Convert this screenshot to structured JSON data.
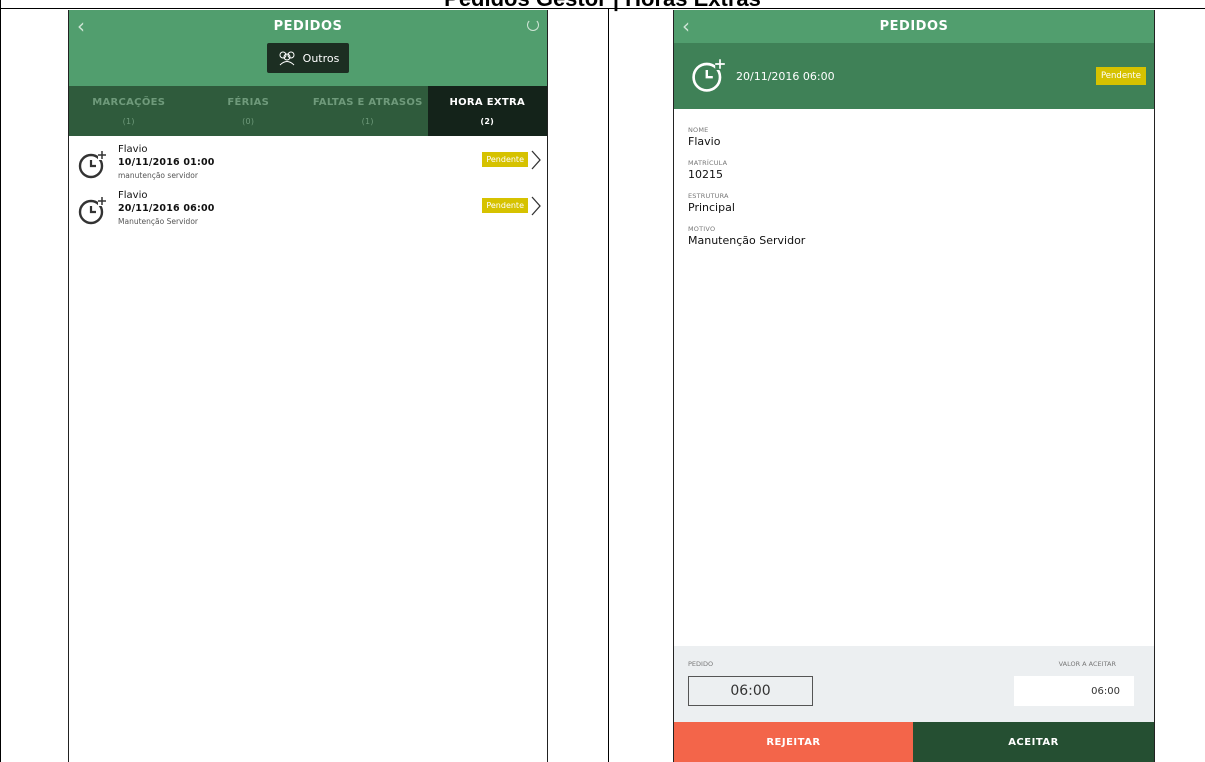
{
  "document": {
    "title": "Pedidos Gestor | Horas Extras"
  },
  "left": {
    "header": {
      "back_icon": "chevron-left-icon",
      "title": "PEDIDOS",
      "refresh_icon": "refresh-icon"
    },
    "filter": {
      "label": "Outros",
      "icon": "people-icon"
    },
    "tabs": [
      {
        "label": "MARCAÇÕES",
        "count": "(1)"
      },
      {
        "label": "FÉRIAS",
        "count": "(0)"
      },
      {
        "label": "FALTAS E ATRASOS",
        "count": "(1)"
      },
      {
        "label": "HORA EXTRA",
        "count": "(2)"
      }
    ],
    "active_tab": "HORA EXTRA",
    "items": [
      {
        "name": "Flavio",
        "datetime": "10/11/2016 01:00",
        "reason": "manutenção servidor",
        "status": "Pendente"
      },
      {
        "name": "Flavio",
        "datetime": "20/11/2016 06:00",
        "reason": "Manutenção Servidor",
        "status": "Pendente"
      }
    ]
  },
  "right": {
    "header": {
      "back_icon": "chevron-left-icon",
      "title": "PEDIDOS"
    },
    "summary": {
      "icon": "clock-plus-icon",
      "datetime": "20/11/2016 06:00",
      "status": "Pendente"
    },
    "fields": [
      {
        "label": "NOME",
        "value": "Flavio"
      },
      {
        "label": "MATRÍCULA",
        "value": "10215"
      },
      {
        "label": "ESTRUTURA",
        "value": "Principal"
      },
      {
        "label": "MOTIVO",
        "value": "Manutenção Servidor"
      }
    ],
    "footer": {
      "pedido_label": "PEDIDO",
      "pedido_value": "06:00",
      "aceitar_label": "VALOR A ACEITAR",
      "aceitar_value": "06:00"
    },
    "actions": {
      "reject": "REJEITAR",
      "accept": "ACEITAR"
    }
  },
  "colors": {
    "header_green": "#519e6e",
    "tabs_green": "#2f5b3c",
    "band_green": "#3f8157",
    "pending_badge": "#d6c200",
    "reject": "#f3654a",
    "accept": "#254f32"
  }
}
